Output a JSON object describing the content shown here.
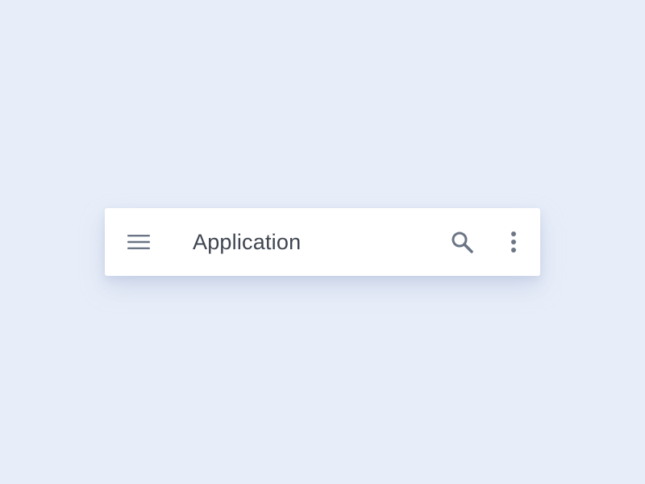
{
  "toolbar": {
    "title": "Application",
    "menu_icon": "hamburger-menu-icon",
    "search_icon": "search-icon",
    "more_icon": "more-vertical-icon"
  },
  "colors": {
    "background": "#e8eef9",
    "surface": "#ffffff",
    "icon": "#6b7585",
    "title_text": "#3f4550"
  }
}
